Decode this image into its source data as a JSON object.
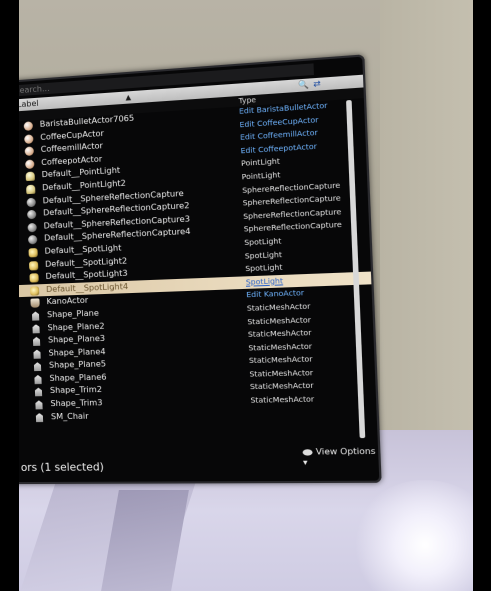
{
  "panel": {
    "search_placeholder": "Search...",
    "header_label": "Label",
    "column_type": "Type",
    "view_options": "View Options",
    "status": "ors (1 selected)"
  },
  "rows": [
    {
      "name": "BaristaBulletActor7065",
      "type": "Edit BaristaBulletActor",
      "icon": "actor-icon"
    },
    {
      "name": "CoffeeCupActor",
      "type": "Edit CoffeeCupActor",
      "icon": "actor-icon"
    },
    {
      "name": "CoffeemillActor",
      "type": "Edit CoffeemillActor",
      "icon": "actor-icon"
    },
    {
      "name": "CoffeepotActor",
      "type": "Edit CoffeepotActor",
      "icon": "actor-icon"
    },
    {
      "name": "Default__PointLight",
      "type": "PointLight",
      "icon": "point-light-icon"
    },
    {
      "name": "Default__PointLight2",
      "type": "PointLight",
      "icon": "point-light-icon"
    },
    {
      "name": "Default__SphereReflectionCapture",
      "type": "SphereReflectionCapture",
      "icon": "sphere-reflection-icon"
    },
    {
      "name": "Default__SphereReflectionCapture2",
      "type": "SphereReflectionCapture",
      "icon": "sphere-reflection-icon"
    },
    {
      "name": "Default__SphereReflectionCapture3",
      "type": "SphereReflectionCapture",
      "icon": "sphere-reflection-icon"
    },
    {
      "name": "Default__SphereReflectionCapture4",
      "type": "SphereReflectionCapture",
      "icon": "sphere-reflection-icon"
    },
    {
      "name": "Default__SpotLight",
      "type": "SpotLight",
      "icon": "spot-light-icon"
    },
    {
      "name": "Default__SpotLight2",
      "type": "SpotLight",
      "icon": "spot-light-icon"
    },
    {
      "name": "Default__SpotLight3",
      "type": "SpotLight",
      "icon": "spot-light-icon"
    },
    {
      "name": "Default__SpotLight4",
      "type": "SpotLight",
      "icon": "spot-light-icon"
    },
    {
      "name": "KanoActor",
      "type": "Edit KanoActor",
      "icon": "kano-actor-icon"
    },
    {
      "name": "Shape_Plane",
      "type": "StaticMeshActor",
      "icon": "static-mesh-icon"
    },
    {
      "name": "Shape_Plane2",
      "type": "StaticMeshActor",
      "icon": "static-mesh-icon"
    },
    {
      "name": "Shape_Plane3",
      "type": "StaticMeshActor",
      "icon": "static-mesh-icon"
    },
    {
      "name": "Shape_Plane4",
      "type": "StaticMeshActor",
      "icon": "static-mesh-icon"
    },
    {
      "name": "Shape_Plane5",
      "type": "StaticMeshActor",
      "icon": "static-mesh-icon"
    },
    {
      "name": "Shape_Plane6",
      "type": "StaticMeshActor",
      "icon": "static-mesh-icon"
    },
    {
      "name": "Shape_Trim2",
      "type": "StaticMeshActor",
      "icon": "static-mesh-icon"
    },
    {
      "name": "Shape_Trim3",
      "type": "StaticMeshActor",
      "icon": "static-mesh-icon"
    },
    {
      "name": "SM_Chair",
      "type": "",
      "icon": "static-mesh-icon"
    }
  ],
  "selected_index": 13,
  "colors": {
    "selected_row": "#e8d8bb",
    "link_type": "#6fb4ff",
    "panel_bg": "#070708"
  }
}
